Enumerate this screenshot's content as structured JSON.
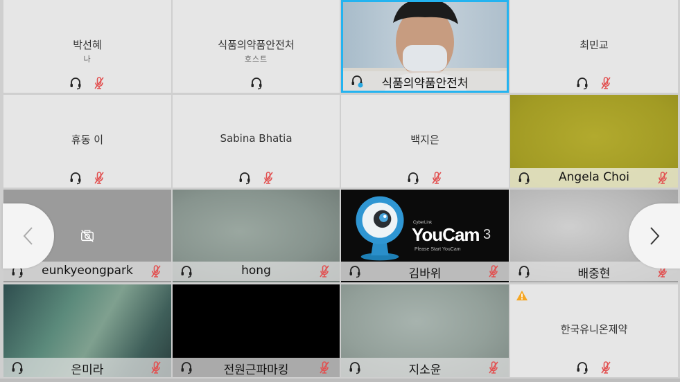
{
  "colors": {
    "accent_border": "#23b3f0",
    "mic_muted": "#e25050",
    "tile_bg": "#e6e6e6",
    "warning": "#f5a623"
  },
  "tiles": [
    {
      "name": "박선혜",
      "sub": "나",
      "mode": "center",
      "muted": true
    },
    {
      "name": "식품의약품안전처",
      "sub": "호스트",
      "mode": "center",
      "muted": false
    },
    {
      "name": "식품의약품안전처",
      "mode": "video",
      "muted": false,
      "selected": true
    },
    {
      "name": "최민교",
      "mode": "center",
      "muted": true
    },
    {
      "name": "휴동 이",
      "mode": "center",
      "muted": true
    },
    {
      "name": "Sabina Bhatia",
      "mode": "center",
      "muted": true
    },
    {
      "name": "백지은",
      "mode": "center",
      "muted": true
    },
    {
      "name": "Angela Choi",
      "mode": "video",
      "muted": true
    },
    {
      "name": "eunkyeongpark",
      "mode": "video",
      "muted": true,
      "camera_off": true
    },
    {
      "name": "hong",
      "mode": "video",
      "muted": true
    },
    {
      "name": "김바위",
      "mode": "video",
      "muted": true
    },
    {
      "name": "배중현",
      "mode": "video",
      "muted": true
    },
    {
      "name": "은미라",
      "mode": "video",
      "muted": true
    },
    {
      "name": "전원근파마킹",
      "mode": "video",
      "muted": true
    },
    {
      "name": "지소윤",
      "mode": "video",
      "muted": true
    },
    {
      "name": "한국유니온제약",
      "mode": "center",
      "muted": true,
      "warning": true
    }
  ],
  "youcam": {
    "brand": "CyberLink",
    "title": "YouCam",
    "version": "3",
    "subtitle": "Please Start YouCam"
  },
  "nav": {
    "prev_icon": "chevron-left-icon",
    "next_icon": "chevron-right-icon"
  }
}
